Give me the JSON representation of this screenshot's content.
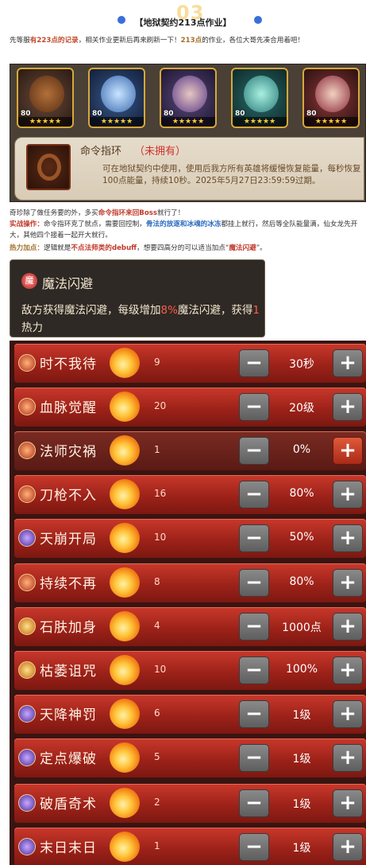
{
  "header": {
    "number": "03",
    "title": "【地狱契约213点作业】"
  },
  "intro": {
    "p1_a": "先等服",
    "p1_b": "有223点的记录",
    "p1_c": "，相关作业更新后再来刷新一下！",
    "p1_d": "213点",
    "p1_e": "的作业，各位大哥先凑合用着吧！"
  },
  "heroes": [
    {
      "level": "80",
      "stars": "★★★★★"
    },
    {
      "level": "80",
      "stars": "★★★★★"
    },
    {
      "level": "80",
      "stars": "★★★★★"
    },
    {
      "level": "80",
      "stars": "★★★★★"
    },
    {
      "level": "80",
      "stars": "★★★★★"
    }
  ],
  "item": {
    "name": "命令指环",
    "owned": "（未拥有）",
    "desc": "可在地狱契约中使用，使用后我方所有英雄将缓慢恢复能量，每秒恢复100点能量，持续10秒。2025年5月27日23:59:59过期。"
  },
  "notes": {
    "n1_a": "奇珍除了做任务要的外，多买",
    "n1_b": "命令指环来回Boss",
    "n1_c": "就行了！",
    "n2_label": "实战操作：",
    "n2_a": "命令指环克了就点，需要回控制，",
    "n2_b": "骨法的放逐和冰魂的冰冻",
    "n2_c": "都挂上就行，然后等全队能量满，仙女龙先开大，其他四个接着一起开大就行。",
    "n3_label": "热力加点：",
    "n3_a": "逻辑就是",
    "n3_b": "不点法师类的debuff",
    "n3_c": "，想要四高分的可以适当加点“",
    "n3_d": "魔法闪避",
    "n3_e": "”。"
  },
  "tooltip": {
    "icon": "魔",
    "name": "魔法闪避",
    "desc_a": "敌方获得魔法闪避，每级增加",
    "desc_pct": "8%",
    "desc_b": "魔法闪避，获得",
    "desc_heat": "1",
    "desc_c": "热力"
  },
  "talents": [
    {
      "name": "时不我待",
      "heat": "9",
      "value": "30秒",
      "minus": "−",
      "plus": "+",
      "icon": "clock-icon"
    },
    {
      "name": "血脉觉醒",
      "heat": "20",
      "value": "20级",
      "minus": "−",
      "plus": "+",
      "icon": "level-icon"
    },
    {
      "name": "法师灾祸",
      "heat": "1",
      "value": "0%",
      "minus": "−",
      "plus": "+",
      "icon": "shield-icon"
    },
    {
      "name": "刀枪不入",
      "heat": "16",
      "value": "80%",
      "minus": "−",
      "plus": "+",
      "icon": "armor-icon"
    },
    {
      "name": "天崩开局",
      "heat": "10",
      "value": "50%",
      "minus": "−",
      "plus": "+",
      "icon": "crack-icon"
    },
    {
      "name": "持续不再",
      "heat": "8",
      "value": "80%",
      "minus": "−",
      "plus": "+",
      "icon": "heart-icon"
    },
    {
      "name": "石肤加身",
      "heat": "4",
      "value": "1000点",
      "minus": "−",
      "plus": "+",
      "icon": "stone-icon"
    },
    {
      "name": "枯萎诅咒",
      "heat": "10",
      "value": "100%",
      "minus": "−",
      "plus": "+",
      "icon": "curse-icon"
    },
    {
      "name": "天降神罚",
      "heat": "6",
      "value": "1级",
      "minus": "−",
      "plus": "+",
      "icon": "star-icon"
    },
    {
      "name": "定点爆破",
      "heat": "5",
      "value": "1级",
      "minus": "−",
      "plus": "+",
      "icon": "bomb-icon"
    },
    {
      "name": "破盾奇术",
      "heat": "2",
      "value": "1级",
      "minus": "−",
      "plus": "+",
      "icon": "break-shield-icon"
    },
    {
      "name": "末日末日",
      "heat": "1",
      "value": "1级",
      "minus": "−",
      "plus": "+",
      "icon": "doom-icon"
    }
  ]
}
